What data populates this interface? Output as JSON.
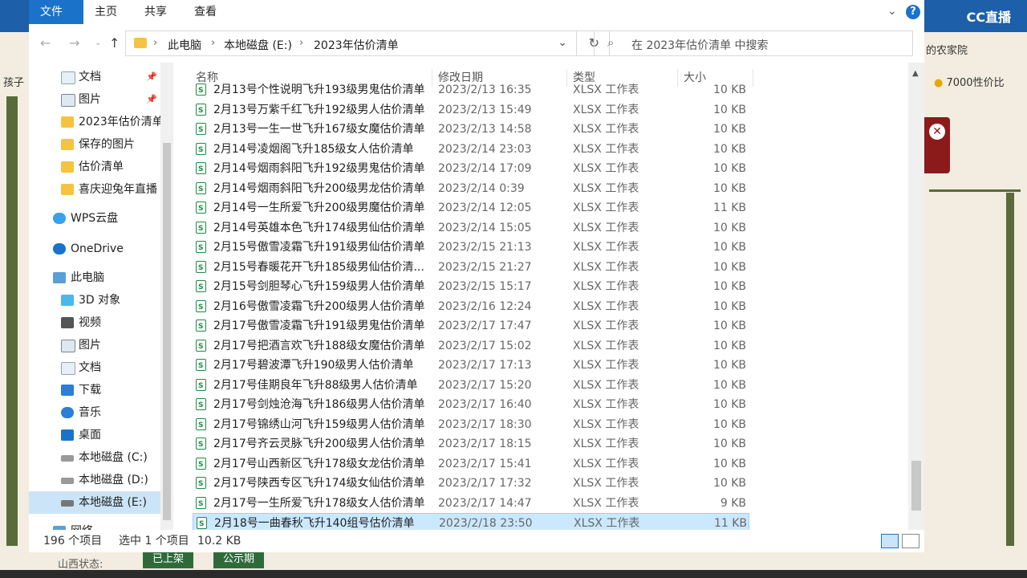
{
  "ribbon": {
    "tabs": [
      "文件",
      "主页",
      "共享",
      "查看"
    ]
  },
  "address": {
    "crumbs": [
      "此电脑",
      "本地磁盘 (E:)",
      "2023年估价清单"
    ],
    "search_placeholder": "在 2023年估价清单 中搜索"
  },
  "sidebar": {
    "items": [
      {
        "label": "文档",
        "icon": "document-icon"
      },
      {
        "label": "图片",
        "icon": "picture-icon"
      },
      {
        "label": "2023年估价清单",
        "icon": "folder-icon"
      },
      {
        "label": "保存的图片",
        "icon": "folder-icon"
      },
      {
        "label": "估价清单",
        "icon": "folder-icon"
      },
      {
        "label": "喜庆迎兔年直播",
        "icon": "folder-icon"
      },
      {
        "label": "WPS云盘",
        "icon": "cloud-icon"
      },
      {
        "label": "OneDrive",
        "icon": "cloud-icon"
      },
      {
        "label": "此电脑",
        "icon": "computer-icon"
      },
      {
        "label": "3D 对象",
        "icon": "cube-icon"
      },
      {
        "label": "视频",
        "icon": "video-icon"
      },
      {
        "label": "图片",
        "icon": "picture-icon"
      },
      {
        "label": "文档",
        "icon": "document-icon"
      },
      {
        "label": "下载",
        "icon": "download-icon"
      },
      {
        "label": "音乐",
        "icon": "music-icon"
      },
      {
        "label": "桌面",
        "icon": "desktop-icon"
      },
      {
        "label": "本地磁盘 (C:)",
        "icon": "drive-icon"
      },
      {
        "label": "本地磁盘 (D:)",
        "icon": "drive-icon"
      },
      {
        "label": "本地磁盘 (E:)",
        "icon": "drive-icon"
      },
      {
        "label": "网络",
        "icon": "network-icon"
      }
    ]
  },
  "columns": {
    "name": "名称",
    "date": "修改日期",
    "type": "类型",
    "size": "大小"
  },
  "files": [
    {
      "name": "2月13号个性说明飞升193级男鬼估价清单",
      "date": "2023/2/13 16:35",
      "type": "XLSX 工作表",
      "size": "10 KB"
    },
    {
      "name": "2月13号万紫千红飞升192级男人估价清单",
      "date": "2023/2/13 15:49",
      "type": "XLSX 工作表",
      "size": "10 KB"
    },
    {
      "name": "2月13号一生一世飞升167级女魔估价清单",
      "date": "2023/2/13 14:58",
      "type": "XLSX 工作表",
      "size": "10 KB"
    },
    {
      "name": "2月14号凌烟阁飞升185级女人估价清单",
      "date": "2023/2/14 23:03",
      "type": "XLSX 工作表",
      "size": "10 KB"
    },
    {
      "name": "2月14号烟雨斜阳飞升192级男鬼估价清单",
      "date": "2023/2/14 17:09",
      "type": "XLSX 工作表",
      "size": "10 KB"
    },
    {
      "name": "2月14号烟雨斜阳飞升200级男龙估价清单",
      "date": "2023/2/14 0:39",
      "type": "XLSX 工作表",
      "size": "10 KB"
    },
    {
      "name": "2月14号一生所爱飞升200级男魔估价清单",
      "date": "2023/2/14 12:05",
      "type": "XLSX 工作表",
      "size": "11 KB"
    },
    {
      "name": "2月14号英雄本色飞升174级男仙估价清单",
      "date": "2023/2/14 15:05",
      "type": "XLSX 工作表",
      "size": "10 KB"
    },
    {
      "name": "2月15号傲雪凌霜飞升191级男仙估价清单",
      "date": "2023/2/15 21:13",
      "type": "XLSX 工作表",
      "size": "10 KB"
    },
    {
      "name": "2月15号春暖花开飞升185级男仙估价清...",
      "date": "2023/2/15 21:27",
      "type": "XLSX 工作表",
      "size": "10 KB"
    },
    {
      "name": "2月15号剑胆琴心飞升159级男人估价清单",
      "date": "2023/2/15 15:17",
      "type": "XLSX 工作表",
      "size": "10 KB"
    },
    {
      "name": "2月16号傲雪凌霜飞升200级男人估价清单",
      "date": "2023/2/16 12:24",
      "type": "XLSX 工作表",
      "size": "10 KB"
    },
    {
      "name": "2月17号傲雪凌霜飞升191级男鬼估价清单",
      "date": "2023/2/17 17:47",
      "type": "XLSX 工作表",
      "size": "10 KB"
    },
    {
      "name": "2月17号把酒言欢飞升188级女魔估价清单",
      "date": "2023/2/17 15:02",
      "type": "XLSX 工作表",
      "size": "10 KB"
    },
    {
      "name": "2月17号碧波潭飞升190级男人估价清单",
      "date": "2023/2/17 17:13",
      "type": "XLSX 工作表",
      "size": "10 KB"
    },
    {
      "name": "2月17号佳期良年飞升88级男人估价清单",
      "date": "2023/2/17 15:20",
      "type": "XLSX 工作表",
      "size": "10 KB"
    },
    {
      "name": "2月17号剑烛沧海飞升186级男人估价清单",
      "date": "2023/2/17 16:40",
      "type": "XLSX 工作表",
      "size": "10 KB"
    },
    {
      "name": "2月17号锦绣山河飞升159级男人估价清单",
      "date": "2023/2/17 18:30",
      "type": "XLSX 工作表",
      "size": "10 KB"
    },
    {
      "name": "2月17号齐云灵脉飞升200级男人估价清单",
      "date": "2023/2/17 18:15",
      "type": "XLSX 工作表",
      "size": "10 KB"
    },
    {
      "name": "2月17号山西新区飞升178级女龙估价清单",
      "date": "2023/2/17 15:41",
      "type": "XLSX 工作表",
      "size": "10 KB"
    },
    {
      "name": "2月17号陕西专区飞升174级女仙估价清单",
      "date": "2023/2/17 17:32",
      "type": "XLSX 工作表",
      "size": "10 KB"
    },
    {
      "name": "2月17号一生所爱飞升178级女人估价清单",
      "date": "2023/2/17 14:47",
      "type": "XLSX 工作表",
      "size": "9 KB"
    },
    {
      "name": "2月18号一曲春秋飞升140组号估价清单",
      "date": "2023/2/18 23:50",
      "type": "XLSX 工作表",
      "size": "11 KB",
      "selected": true
    }
  ],
  "status": {
    "count": "196 个项目",
    "selected": "选中 1 个项目",
    "size": "10.2 KB"
  },
  "external": {
    "logo": "CC直播",
    "right_top": "的农家院",
    "right_badge": "7000性价比",
    "left_top": "孩子",
    "bottom_label": "山西状态:",
    "btn1": "已上架",
    "btn2": "公示期"
  }
}
